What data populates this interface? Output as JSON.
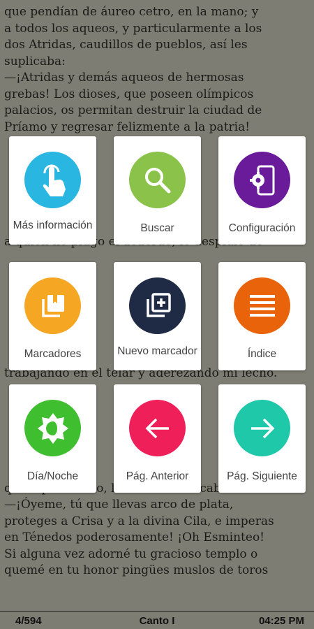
{
  "reader": {
    "lines": [
      "que pendían de áureo cetro, en la mano; y",
      "a todos los aqueos, y particularmente a los",
      "dos Atridas, caudillos de pueblos, así les",
      "suplicaba:",
      "—¡Atridas y demás aqueos de hermosas",
      "grebas! Los dioses, que poseen olímpicos",
      "palacios, os permitan destruir la ciudad de",
      "Príamo y regresar felizmente a la patria!",
      "",
      "",
      "",
      "",
      "",
      "",
      "a quien no plugo el acuerdo, le despidió de",
      "",
      "",
      "",
      "",
      "",
      "",
      "",
      "trabajando en el telar y aderezando mi lecho.",
      "",
      "",
      "",
      "",
      "",
      "",
      "quien parió Leto, la de hermosa cabellera:",
      "—¡Óyeme, tú que llevas arco de plata,",
      "proteges a Crisa y a la divina Cila, e imperas",
      "en Ténedos poderosamente! ¡Oh Esminteo!",
      "Si alguna vez adorné tu gracioso templo o",
      "quemé en tu honor pingües muslos de toros"
    ]
  },
  "menu": {
    "more_info": "Más información",
    "search": "Buscar",
    "settings": "Configuración",
    "bookmarks": "Marcadores",
    "new_bookmark": "Nuevo marcador",
    "index": "Índice",
    "day_night": "Día/Noche",
    "prev_page": "Pág. Anterior",
    "next_page": "Pág. Siguiente"
  },
  "icons": {
    "more_info": "touch-hand-icon",
    "search": "magnifier-icon",
    "settings": "phone-settings-icon",
    "bookmarks": "bookmarks-icon",
    "new_bookmark": "add-bookmark-icon",
    "index": "list-icon",
    "day_night": "brightness-icon",
    "prev_page": "arrow-left-icon",
    "next_page": "arrow-right-icon"
  },
  "colors": {
    "more_info": "#29b6e0",
    "search": "#8bc34a",
    "settings": "#6a1b9a",
    "bookmarks": "#f5a623",
    "new_bookmark": "#1f2a44",
    "index": "#e8630a",
    "day_night": "#3fbf2f",
    "prev_page": "#ef1f5a",
    "next_page": "#1ec8a8"
  },
  "status": {
    "page": "4/594",
    "chapter": "Canto I",
    "time": "04:25 PM"
  }
}
